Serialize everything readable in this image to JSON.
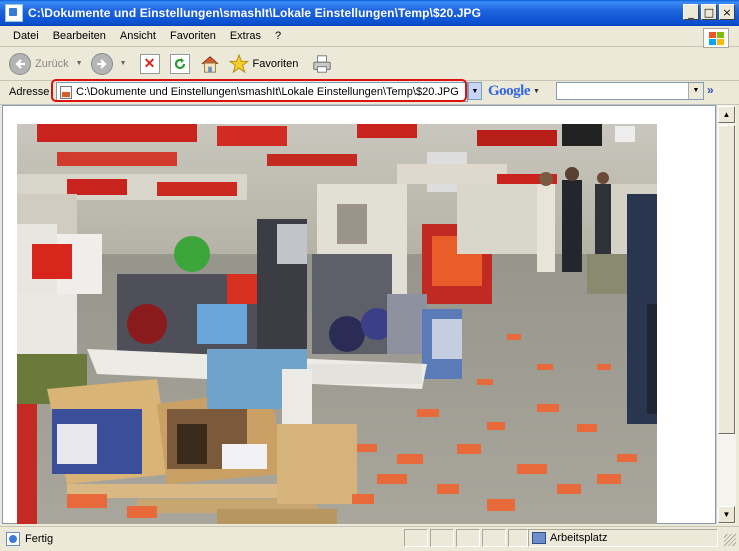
{
  "window": {
    "title": "C:\\Dokumente und Einstellungen\\smashIt\\Lokale Einstellungen\\Temp\\$20.JPG",
    "controls": {
      "minimize": "_",
      "maximize": "□",
      "close": "×"
    }
  },
  "menu": {
    "items": [
      "Datei",
      "Bearbeiten",
      "Ansicht",
      "Favoriten",
      "Extras",
      "?"
    ]
  },
  "toolbar": {
    "back_label": "Zurück",
    "favorites_label": "Favoriten",
    "icons": [
      "back-arrow-icon",
      "forward-arrow-icon",
      "stop-icon",
      "refresh-icon",
      "home-icon",
      "star-icon",
      "printer-icon"
    ]
  },
  "address": {
    "label": "Adresse",
    "value": "C:\\Dokumente und Einstellungen\\smashIt\\Lokale Einstellungen\\Temp\\$20.JPG",
    "highlight_color": "#e01010"
  },
  "search": {
    "brand": "Google",
    "value": "",
    "more": "»"
  },
  "status": {
    "text": "Fertig",
    "zone": "Arbeitsplatz"
  },
  "colors": {
    "titlebar": "#0b4fcf",
    "chrome": "#ece9d8"
  }
}
